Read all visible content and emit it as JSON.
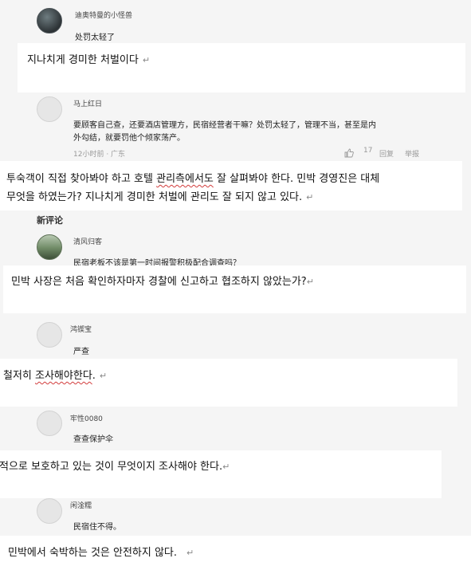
{
  "comments": [
    {
      "user": "迪奥特曼的小怪兽",
      "text": "处罚太轻了"
    },
    {
      "user": "马上红日",
      "text_line1": "要顾客自己查，还要酒店管理方，民宿经营者干嘛？处罚太轻了，管理不当，甚至是内",
      "text_line2": "外勾结，就要罚他个倾家荡产。",
      "time": "12小时前 · 广东",
      "likes": "17",
      "reply": "回复",
      "report": "举报"
    },
    {
      "user": "清风归客",
      "text": "民宿老板不该是第一时间报警积极配合调查吗？"
    },
    {
      "user": "鸿锲宝",
      "text": "严查"
    },
    {
      "user": "牢性0080",
      "text": "查查保护伞"
    },
    {
      "user": "闲淦糯",
      "text": "民宿住不得。"
    }
  ],
  "section_title": "新评论",
  "translations": {
    "t1": "지나치게 경미한 처벌이다",
    "t2_line1_a": "투숙객이 직접 찾아봐야 하고 호텔 ",
    "t2_line1_b": "관리측에서도",
    "t2_line1_c": " 잘 살펴봐야 한다. 민박 경영진은 대체",
    "t2_line2": "무엇을 하였는가? 지나치게 경미한 처벌에 관리도 잘 되지 않고 있다.",
    "t3": "민박 사장은 처음 확인하자마자 경찰에 신고하고 협조하지 않았는가?",
    "t4_a": "철저히 ",
    "t4_b": "조사해야한다",
    "t4_c": ".",
    "t5": "적으로 보호하고 있는 것이 무엇이지 조사해야 한다.",
    "t6": "민박에서 숙박하는 것은 안전하지 않다."
  },
  "return_mark": "↵",
  "icons": {
    "like": "thumbs-up-icon",
    "avatar": "avatar-placeholder"
  }
}
